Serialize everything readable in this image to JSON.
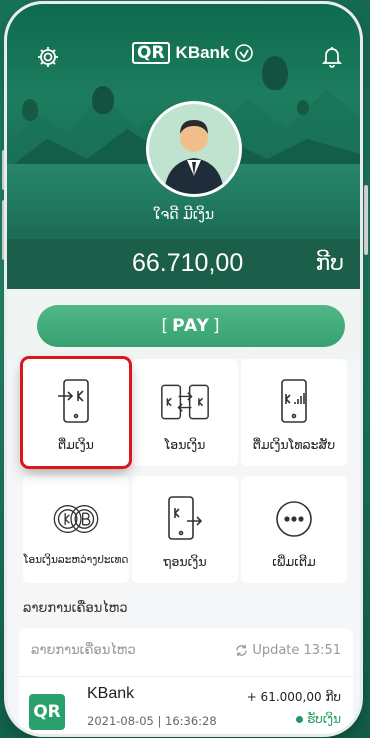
{
  "header": {
    "logo_qr": "QR",
    "logo_brand": "KBank",
    "user_name": "ໃຈດີ ມີເງິນ",
    "balance": "66.710,00",
    "currency": "ກີບ"
  },
  "pay_button": {
    "label": "PAY"
  },
  "services": [
    {
      "label": "ຕື່ມເງິນ",
      "icon": "phone-topup-icon"
    },
    {
      "label": "ໂອນເງິນ",
      "icon": "transfer-icon"
    },
    {
      "label": "ຕື່ມເງິນໂທລະສັບ",
      "icon": "mobile-topup-icon"
    },
    {
      "label": "ໂອນເງິນລະຫວ່າງປະເທດ",
      "icon": "currency-exchange-icon"
    },
    {
      "label": "ຖອນເງິນ",
      "icon": "withdraw-icon"
    },
    {
      "label": "ເພີ່ມເຕີມ",
      "icon": "more-icon"
    }
  ],
  "recent": {
    "section_title": "ລາຍການເຄື່ອນໄຫວ",
    "card_title": "ລາຍການເຄື່ອນໄຫວ",
    "update_label": "Update 13:51",
    "item": {
      "logo": "QR",
      "name": "KBank",
      "date": "2021-08-05 | 16:36:28",
      "amount": "+ 61.000,00 ກີບ",
      "status": "ຮັບເງິນ"
    }
  },
  "colors": {
    "brand_green": "#1a7a62",
    "pay_green": "#3fa873",
    "highlight_red": "#e0141c"
  }
}
